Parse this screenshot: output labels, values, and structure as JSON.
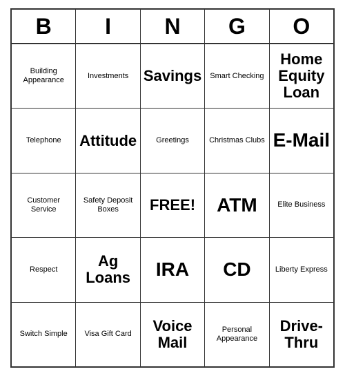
{
  "header": {
    "letters": [
      "B",
      "I",
      "N",
      "G",
      "O"
    ]
  },
  "rows": [
    [
      {
        "text": "Building Appearance",
        "size": "small"
      },
      {
        "text": "Investments",
        "size": "small"
      },
      {
        "text": "Savings",
        "size": "large"
      },
      {
        "text": "Smart Checking",
        "size": "small"
      },
      {
        "text": "Home Equity Loan",
        "size": "large"
      }
    ],
    [
      {
        "text": "Telephone",
        "size": "small"
      },
      {
        "text": "Attitude",
        "size": "large"
      },
      {
        "text": "Greetings",
        "size": "small"
      },
      {
        "text": "Christmas Clubs",
        "size": "small"
      },
      {
        "text": "E-Mail",
        "size": "xlarge"
      }
    ],
    [
      {
        "text": "Customer Service",
        "size": "small"
      },
      {
        "text": "Safety Deposit Boxes",
        "size": "small"
      },
      {
        "text": "FREE!",
        "size": "large"
      },
      {
        "text": "ATM",
        "size": "xlarge"
      },
      {
        "text": "Elite Business",
        "size": "small"
      }
    ],
    [
      {
        "text": "Respect",
        "size": "small"
      },
      {
        "text": "Ag Loans",
        "size": "large"
      },
      {
        "text": "IRA",
        "size": "xlarge"
      },
      {
        "text": "CD",
        "size": "xlarge"
      },
      {
        "text": "Liberty Express",
        "size": "small"
      }
    ],
    [
      {
        "text": "Switch Simple",
        "size": "small"
      },
      {
        "text": "Visa Gift Card",
        "size": "small"
      },
      {
        "text": "Voice Mail",
        "size": "large"
      },
      {
        "text": "Personal Appearance",
        "size": "small"
      },
      {
        "text": "Drive-Thru",
        "size": "large"
      }
    ]
  ]
}
